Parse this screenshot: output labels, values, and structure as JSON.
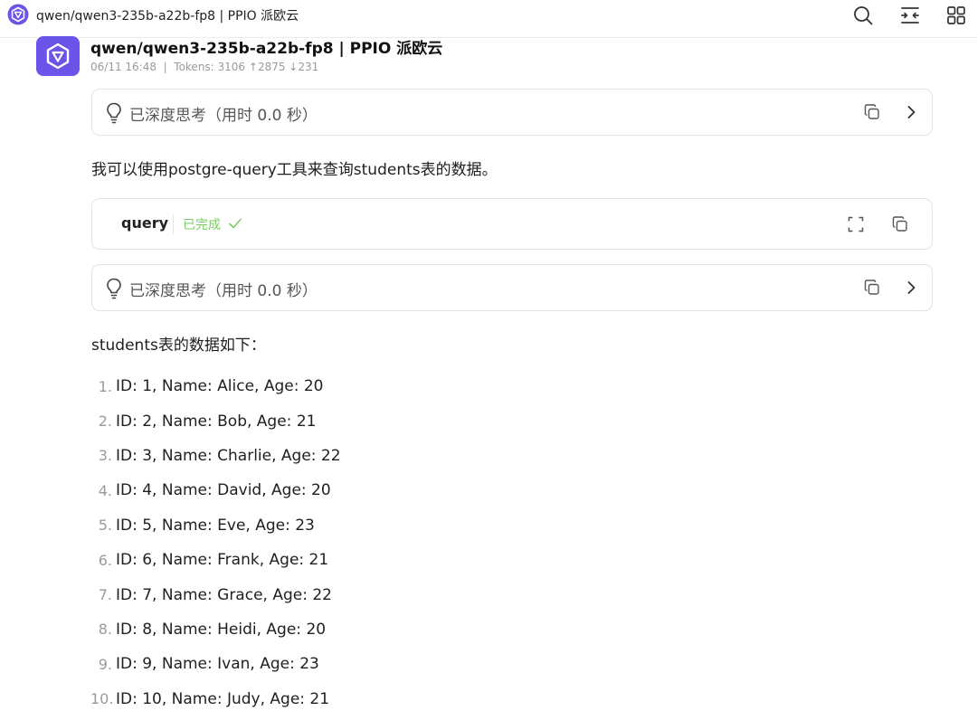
{
  "window": {
    "title": "qwen/qwen3-235b-a22b-fp8 | PPIO 派欧云",
    "icons": [
      "search-icon",
      "toggle-panel-icon",
      "grid-icon"
    ]
  },
  "message": {
    "title": "qwen/qwen3-235b-a22b-fp8 | PPIO 派欧云",
    "meta": "06/11 16:48  |  Tokens: 3106 ↑2875 ↓231"
  },
  "thinking_1": {
    "label": "已深度思考（用时 0.0 秒）"
  },
  "intro_text": "我可以使用postgre-query工具来查询students表的数据。",
  "tool_call": {
    "name": "query",
    "status": "已完成",
    "status_color": "#7ecb67"
  },
  "thinking_2": {
    "label": "已深度思考（用时 0.0 秒）"
  },
  "result_intro": "students表的数据如下：",
  "results": [
    {
      "num": "1.",
      "text": "ID: 1, Name: Alice, Age: 20"
    },
    {
      "num": "2.",
      "text": "ID: 2, Name: Bob, Age: 21"
    },
    {
      "num": "3.",
      "text": "ID: 3, Name: Charlie, Age: 22"
    },
    {
      "num": "4.",
      "text": "ID: 4, Name: David, Age: 20"
    },
    {
      "num": "5.",
      "text": "ID: 5, Name: Eve, Age: 23"
    },
    {
      "num": "6.",
      "text": "ID: 6, Name: Frank, Age: 21"
    },
    {
      "num": "7.",
      "text": "ID: 7, Name: Grace, Age: 22"
    },
    {
      "num": "8.",
      "text": "ID: 8, Name: Heidi, Age: 20"
    },
    {
      "num": "9.",
      "text": "ID: 9, Name: Ivan, Age: 23"
    },
    {
      "num": "10.",
      "text": "ID: 10, Name: Judy, Age: 21"
    }
  ],
  "colors": {
    "brand": "#6a55e8",
    "success": "#7ecb67",
    "muted": "#9a9a9a"
  }
}
